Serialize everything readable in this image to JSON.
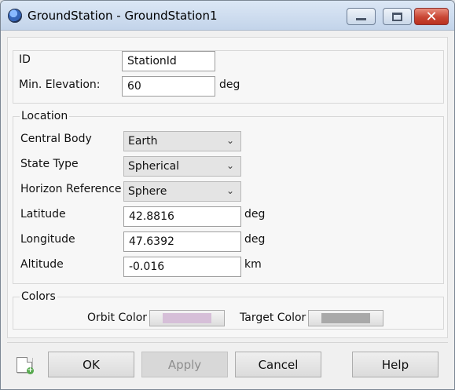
{
  "window": {
    "title": "GroundStation - GroundStation1",
    "controls": {
      "minimize": "minimize",
      "maximize": "maximize",
      "close": "✕"
    }
  },
  "form": {
    "id_label": "ID",
    "id_value": "StationId",
    "min_elevation_label": "Min. Elevation:",
    "min_elevation_value": "60",
    "min_elevation_unit": "deg",
    "location_section": "Location",
    "central_body_label": "Central Body",
    "central_body_value": "Earth",
    "state_type_label": "State Type",
    "state_type_value": "Spherical",
    "horizon_reference_label": "Horizon Reference",
    "horizon_reference_value": "Sphere",
    "latitude_label": "Latitude",
    "latitude_value": "42.8816",
    "latitude_unit": "deg",
    "longitude_label": "Longitude",
    "longitude_value": "47.6392",
    "longitude_unit": "deg",
    "altitude_label": "Altitude",
    "altitude_value": "-0.016",
    "altitude_unit": "km",
    "colors_section": "Colors",
    "orbit_color_label": "Orbit Color",
    "target_color_label": "Target Color"
  },
  "colors": {
    "orbit": "#d6bfd8",
    "target": "#a9a9a9"
  },
  "footer": {
    "ok": "OK",
    "apply": "Apply",
    "cancel": "Cancel",
    "help": "Help"
  }
}
